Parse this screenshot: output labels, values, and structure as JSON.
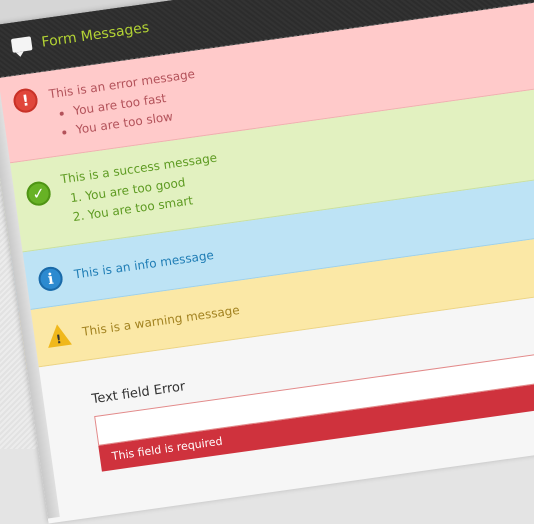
{
  "panel": {
    "title": "Form Messages",
    "icon": "speech-bubble-icon"
  },
  "messages": {
    "error": {
      "text": "This is an error message",
      "items": [
        "You are too fast",
        "You are too slow"
      ],
      "icon": "exclamation-icon",
      "color": "#e0463b"
    },
    "success": {
      "text": "This is a success message",
      "items": [
        "You are too good",
        "You are too smart"
      ],
      "icon": "checkmark-icon",
      "color": "#67b225"
    },
    "info": {
      "text": "This is an info message",
      "icon": "info-icon",
      "color": "#2c8ad0"
    },
    "warning": {
      "text": "This is a warning message",
      "icon": "warning-triangle-icon",
      "color": "#f0b81c"
    }
  },
  "form": {
    "field_label": "Text field Error",
    "field_value": "",
    "field_error": "This field is required"
  },
  "colors": {
    "accent": "#b3d334",
    "error_bg": "#ffcaca",
    "success_bg": "#e2f1c0",
    "info_bg": "#bde3f5",
    "warning_bg": "#fbe8a6",
    "field_error_bg": "#cf323d"
  }
}
